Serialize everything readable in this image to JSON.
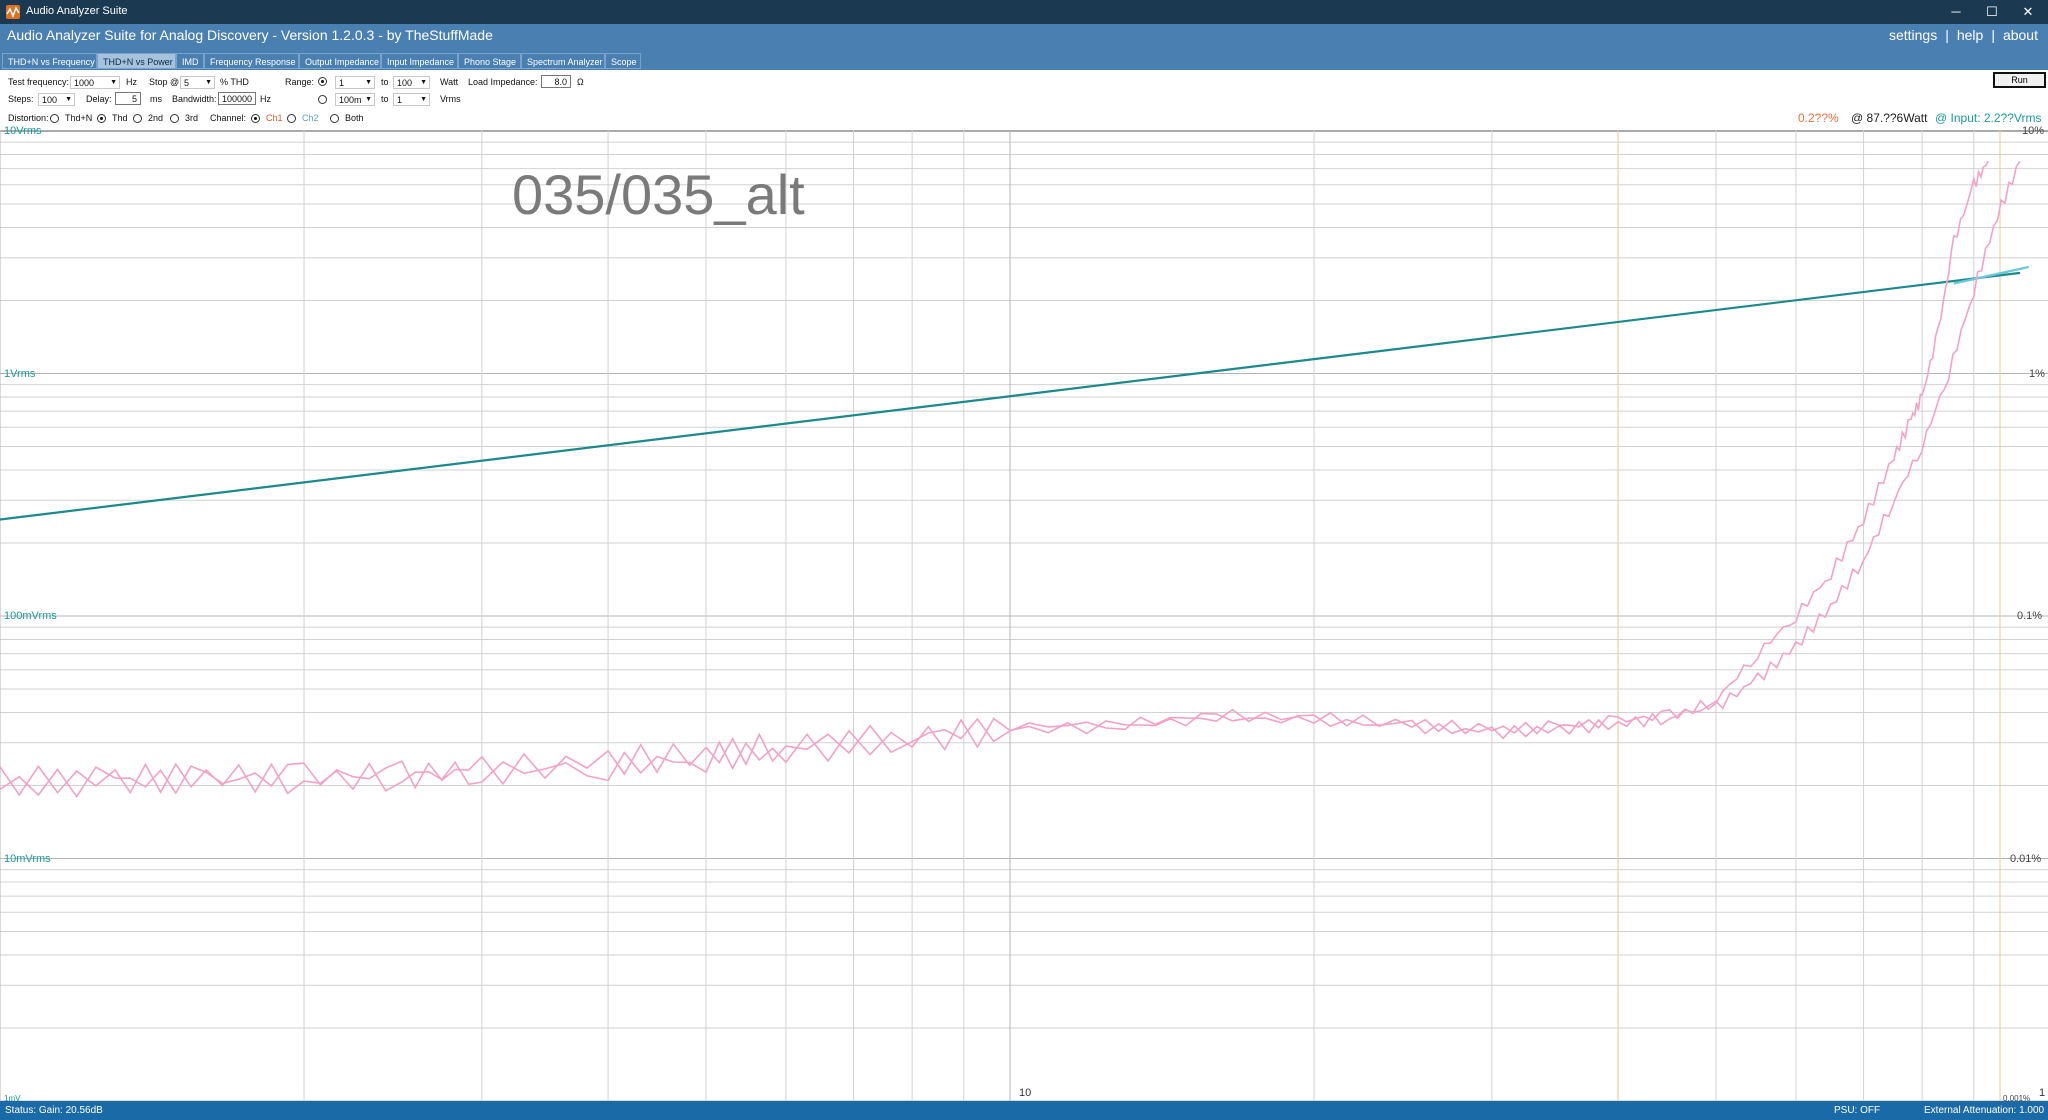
{
  "window": {
    "title": "Audio Analyzer Suite",
    "minimize_glyph": "─",
    "maximize_glyph": "☐",
    "close_glyph": "✕"
  },
  "header": {
    "app_title": "Audio Analyzer Suite for Analog Discovery - Version   1.2.0.3   - by TheStuffMade",
    "links": [
      "settings",
      "help",
      "about"
    ],
    "separator": "|"
  },
  "tabs": [
    {
      "label": "THD+N vs Frequency",
      "active": false
    },
    {
      "label": "THD+N vs Power",
      "active": true
    },
    {
      "label": "IMD",
      "active": false
    },
    {
      "label": "Frequency Response",
      "active": false
    },
    {
      "label": "Output Impedance",
      "active": false
    },
    {
      "label": "Input Impedance",
      "active": false
    },
    {
      "label": "Phono Stage",
      "active": false
    },
    {
      "label": "Spectrum Analyzer",
      "active": false
    },
    {
      "label": "Scope",
      "active": false
    }
  ],
  "controls": {
    "test_frequency_label": "Test frequency:",
    "test_frequency_value": "1000",
    "hz_unit": "Hz",
    "stop_label": "Stop @",
    "stop_value": "5",
    "thd_unit": "% THD",
    "range_label": "Range:",
    "watt_from": "1",
    "to_label": "to",
    "watt_to": "100",
    "watt_unit": "Watt",
    "vrms_from": "100m",
    "vrms_to": "1",
    "vrms_unit": "Vrms",
    "load_impedance_label": "Load Impedance:",
    "load_impedance_value": "8.0",
    "ohm_unit": "Ω",
    "steps_label": "Steps:",
    "steps_value": "100",
    "delay_label": "Delay:",
    "delay_value": "5",
    "ms_unit": "ms",
    "bandwidth_label": "Bandwidth:",
    "bandwidth_value": "100000",
    "distortion_label": "Distortion:",
    "distortion_options": [
      "Thd+N",
      "Thd",
      "2nd",
      "3rd"
    ],
    "distortion_selected": "Thd",
    "channel_label": "Channel:",
    "channel_options": [
      "Ch1",
      "Ch2",
      "Both"
    ],
    "channel_selected": "Ch1",
    "run_label": "Run"
  },
  "readout": {
    "thd": "0.2??%",
    "power": "@ 87.??6Watt",
    "input": "@ Input: 2.2??Vrms"
  },
  "plot": {
    "watermark": "035/035_alt",
    "left_axis_labels": [
      "10Vrms",
      "1Vrms",
      "100mVrms",
      "10mVrms",
      "1mV"
    ],
    "right_axis_labels": [
      "10%",
      "1%",
      "0.1%",
      "0.01%",
      "0.001%"
    ],
    "x_tick_labels": [
      "10",
      "1"
    ]
  },
  "chart_data": {
    "type": "line",
    "x_scale": "log",
    "xlim": [
      1,
      100
    ],
    "left_ylabel": "Vrms",
    "left_ylim": [
      0.001,
      10
    ],
    "right_ylim_percent": [
      0.001,
      10
    ],
    "grid": true,
    "series": [
      {
        "name": "Ch1",
        "axis": "left",
        "unit": "Vrms",
        "x": [
          1,
          100
        ],
        "values": [
          0.25,
          2.6
        ]
      },
      {
        "name": "Ch2",
        "axis": "left",
        "unit": "Vrms",
        "x": [
          86,
          102
        ],
        "values": [
          2.35,
          2.75
        ]
      },
      {
        "name": "Ch1",
        "axis": "right",
        "unit": "%",
        "x": [
          1,
          1.3,
          1.6,
          2,
          2.5,
          3,
          4,
          5,
          6,
          8,
          10,
          13,
          16,
          20,
          25,
          30,
          35,
          40,
          45,
          50,
          55,
          60,
          65,
          70,
          75,
          78,
          80,
          83,
          86,
          90,
          93
        ],
        "values": [
          0.021,
          0.021,
          0.022,
          0.021,
          0.022,
          0.023,
          0.024,
          0.026,
          0.028,
          0.031,
          0.034,
          0.035,
          0.038,
          0.037,
          0.035,
          0.033,
          0.034,
          0.036,
          0.038,
          0.045,
          0.07,
          0.1,
          0.15,
          0.25,
          0.45,
          0.65,
          0.8,
          1.5,
          3.5,
          6.0,
          7.5
        ]
      },
      {
        "name": "Ch1",
        "axis": "right",
        "unit": "%",
        "x": [
          1,
          1.3,
          1.6,
          2,
          2.5,
          3,
          4,
          5,
          6,
          8,
          10,
          13,
          16,
          20,
          25,
          30,
          35,
          40,
          45,
          50,
          55,
          60,
          65,
          70,
          75,
          80,
          85,
          90,
          95,
          100
        ],
        "values": [
          0.02,
          0.021,
          0.021,
          0.022,
          0.022,
          0.023,
          0.025,
          0.027,
          0.029,
          0.032,
          0.035,
          0.036,
          0.039,
          0.038,
          0.036,
          0.034,
          0.035,
          0.037,
          0.039,
          0.042,
          0.055,
          0.075,
          0.11,
          0.17,
          0.3,
          0.5,
          1.0,
          2.2,
          4.5,
          7.5
        ]
      }
    ]
  },
  "status": {
    "left": "Status: Gain: 20.56dB",
    "psu": "PSU: OFF",
    "attenuation": "External Attenuation: 1.000"
  }
}
